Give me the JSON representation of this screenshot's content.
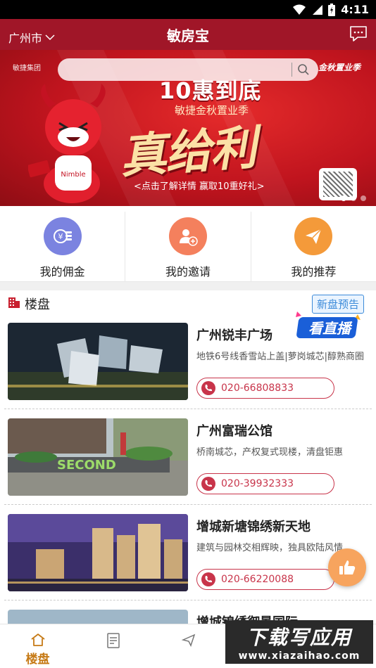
{
  "statusbar": {
    "time": "4:11"
  },
  "header": {
    "city": "广州市",
    "title": "敏房宝"
  },
  "banner": {
    "logo_left": "敏捷集团",
    "logo_right": "金秋置业季",
    "search_placeholder": "",
    "promo_title": "10惠到底",
    "promo_subtitle": "敏捷金秋置业季",
    "promo_headline": "真给利",
    "promo_bar": "<点击了解详情 赢取10重好礼>",
    "slides": 3,
    "active_slide": 1
  },
  "quick_actions": [
    {
      "label": "我的佣金",
      "icon": "coins-icon",
      "color": "#7b83e0"
    },
    {
      "label": "我的邀请",
      "icon": "add-user-icon",
      "color": "#f4805d"
    },
    {
      "label": "我的推荐",
      "icon": "paper-plane-icon",
      "color": "#f49a3a"
    }
  ],
  "section": {
    "title": "楼盘",
    "badge": "新盘预告",
    "live_label": "看直播"
  },
  "listings": [
    {
      "name": "广州锐丰广场",
      "desc": "地铁6号线香雪站上盖|萝岗城芯|醇熟商圈",
      "phone": "020-66808833",
      "scene": "night-towers"
    },
    {
      "name": "广州富瑞公馆",
      "desc": "桥南城芯，产权复式现楼，清盘钜惠",
      "phone": "020-39932333",
      "scene": "street-cafe"
    },
    {
      "name": "增城新塘锦绣新天地",
      "desc": "建筑与园林交相辉映，独具欧陆风情",
      "phone": "020-66220088",
      "scene": "dusk-towers"
    },
    {
      "name": "增城锦绣御景国际",
      "desc": "",
      "phone": "",
      "scene": "aerial"
    }
  ],
  "bottom_nav": [
    {
      "label": "楼盘",
      "icon": "home-icon",
      "active": true
    }
  ],
  "watermark": {
    "main": "下载写应用",
    "sub": "www.xiazaihao.com"
  },
  "colors": {
    "header": "#a01628",
    "accent": "#c8344a",
    "nav_active": "#c67a16"
  }
}
